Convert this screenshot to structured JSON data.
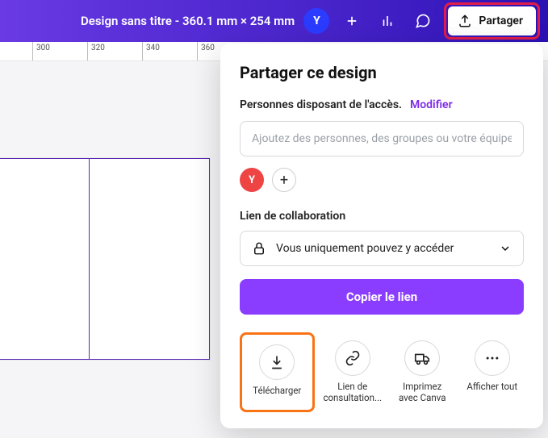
{
  "header": {
    "doc_title": "Design sans titre - 360.1 mm × 254 mm",
    "avatar_initial": "Y",
    "share_label": "Partager"
  },
  "ruler": {
    "marks": [
      300,
      320,
      340,
      360
    ]
  },
  "share_panel": {
    "title": "Partager ce design",
    "access_label": "Personnes disposant de l'accès.",
    "modify_label": "Modifier",
    "people_placeholder": "Ajoutez des personnes, des groupes ou votre équipe",
    "owner_initial": "Y",
    "collab_section": "Lien de collaboration",
    "link_dropdown": "Vous uniquement pouvez y accéder",
    "copy_button": "Copier le lien",
    "actions": {
      "download": "Télécharger",
      "view_link": "Lien de consultation...",
      "print": "Imprimez avec Canva",
      "show_all": "Afficher tout"
    }
  }
}
